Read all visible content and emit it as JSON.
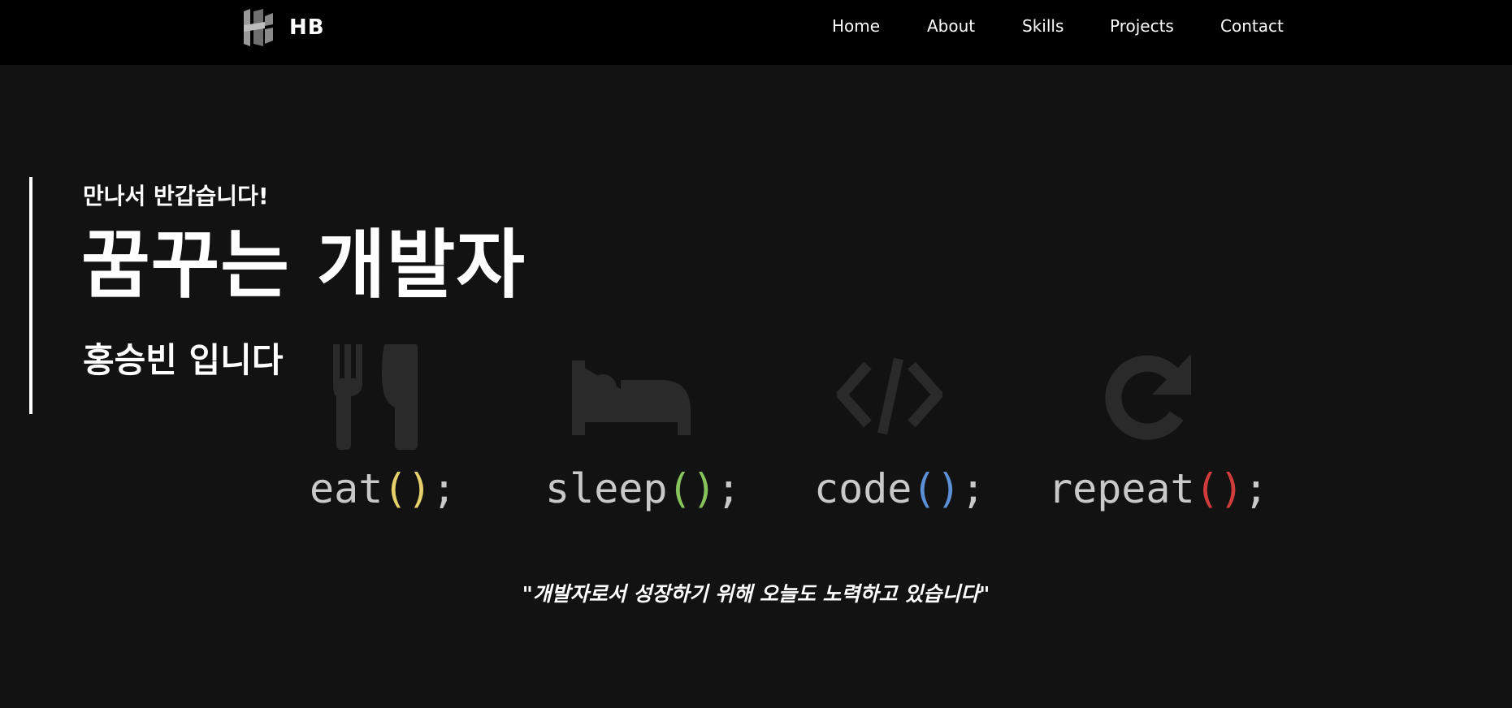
{
  "nav": {
    "brand": "HB",
    "items": [
      "Home",
      "About",
      "Skills",
      "Projects",
      "Contact"
    ]
  },
  "hero": {
    "greeting": "만나서 반갑습니다!",
    "title": "꿈꾸는 개발자",
    "name": "홍승빈 입니다"
  },
  "motto": [
    {
      "word": "eat",
      "paren": "()",
      "semi": ";",
      "color": "#e6d06b",
      "icon": "fork-knife-icon"
    },
    {
      "word": "sleep",
      "paren": "()",
      "semi": ";",
      "color": "#86c35a",
      "icon": "bed-icon"
    },
    {
      "word": "code",
      "paren": "()",
      "semi": ";",
      "color": "#5b8fd6",
      "icon": "code-icon"
    },
    {
      "word": "repeat",
      "paren": "()",
      "semi": ";",
      "color": "#d03b3b",
      "icon": "redo-icon"
    }
  ],
  "quote": "\"개발자로서 성장하기 위해 오늘도 노력하고 있습니다\"",
  "colors": {
    "background": "#121212",
    "navbar": "#000000",
    "text": "#ffffff",
    "code_text": "#c9c9c9",
    "icon": "#2a2a2a"
  }
}
